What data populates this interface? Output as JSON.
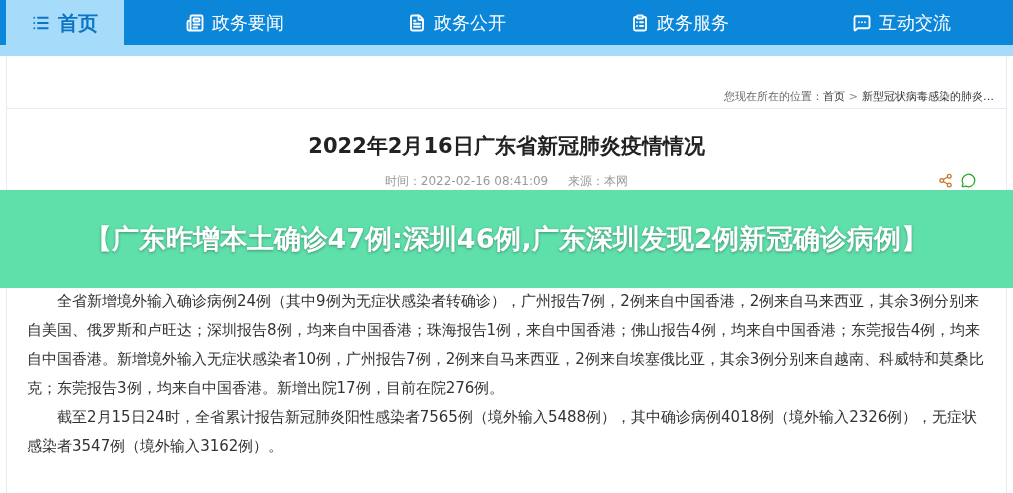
{
  "nav": [
    {
      "label": "首页",
      "selected": true
    },
    {
      "label": "政务要闻",
      "selected": false
    },
    {
      "label": "政务公开",
      "selected": false
    },
    {
      "label": "政务服务",
      "selected": false
    },
    {
      "label": "互动交流",
      "selected": false
    }
  ],
  "breadcrumb": {
    "label": "您现在所在的位置：",
    "items": [
      "首页",
      "新型冠状病毒感染的肺炎…"
    ],
    "separator": ">"
  },
  "article": {
    "title": "2022年2月16日广东省新冠肺炎疫情情况",
    "time": "时间：2022-02-16 08:41:09",
    "source": "来源：本网",
    "paragraphs": [
      "全省新增境外输入确诊病例24例（其中9例为无症状感染者转确诊），广州报告7例，2例来自中国香港，2例来自马来西亚，其余3例分别来自美国、俄罗斯和卢旺达；深圳报告8例，均来自中国香港；珠海报告1例，来自中国香港；佛山报告4例，均来自中国香港；东莞报告4例，均来自中国香港。新增境外输入无症状感染者10例，广州报告7例，2例来自马来西亚，2例来自埃塞俄比亚，其余3例分别来自越南、科威特和莫桑比克；东莞报告3例，均来自中国香港。新增出院17例，目前在院276例。",
      "截至2月15日24时，全省累计报告新冠肺炎阳性感染者7565例（境外输入5488例），其中确诊病例4018例（境外输入2326例），无症状感染者3547例（境外输入3162例）。"
    ]
  },
  "banner": {
    "headline": "【广东昨增本土确诊47例:深圳46例,广东深圳发现2例新冠确诊病例】"
  }
}
